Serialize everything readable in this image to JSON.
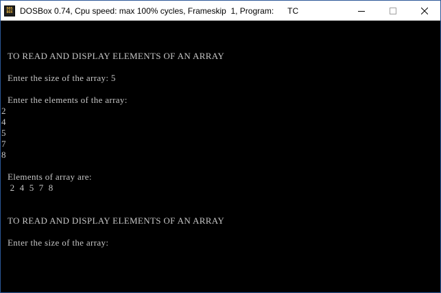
{
  "window": {
    "title": "DOSBox 0.74, Cpu speed: max 100% cycles, Frameskip  1, Program:",
    "program": "TC",
    "icon_top": "DOS",
    "icon_bottom": "BOX",
    "controls": [
      "minimize-icon",
      "maximize-icon",
      "close-icon"
    ]
  },
  "terminal": {
    "background": "#000000",
    "text_color": "#c6c6c6",
    "lines": [
      "TO READ AND DISPLAY ELEMENTS OF AN ARRAY",
      "Enter the size of the array: 5",
      "Enter the elements of the array:",
      "2",
      "4",
      "5",
      "7",
      "8",
      "Elements of array are:",
      " 2  4  5  7  8",
      "TO READ AND DISPLAY ELEMENTS OF AN ARRAY",
      "Enter the size of the array:"
    ]
  }
}
